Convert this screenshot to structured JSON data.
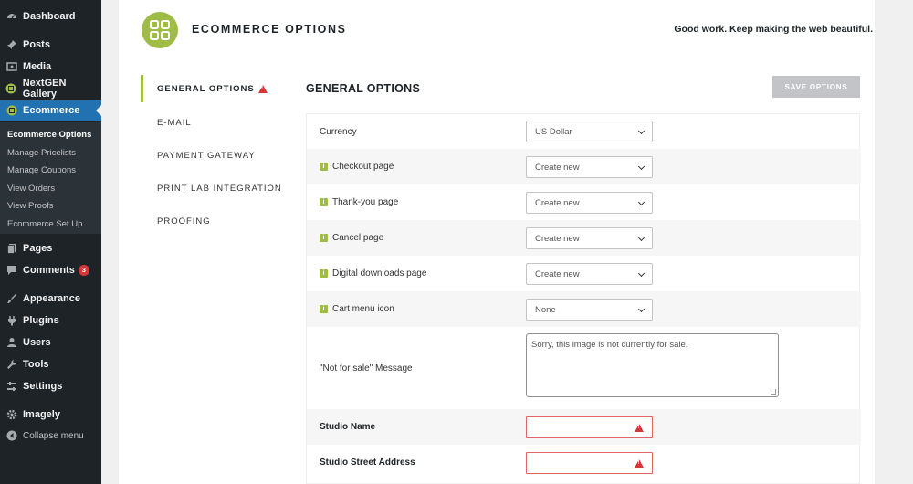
{
  "sidebar": {
    "dashboard": "Dashboard",
    "posts": "Posts",
    "media": "Media",
    "nextgen": "NextGEN Gallery",
    "ecommerce": "Ecommerce",
    "submenu": [
      "Ecommerce Options",
      "Manage Pricelists",
      "Manage Coupons",
      "View Orders",
      "View Proofs",
      "Ecommerce Set Up"
    ],
    "pages": "Pages",
    "comments": "Comments",
    "comments_count": "3",
    "appearance": "Appearance",
    "plugins": "Plugins",
    "users": "Users",
    "tools": "Tools",
    "settings": "Settings",
    "imagely": "Imagely",
    "collapse": "Collapse menu"
  },
  "header": {
    "title": "ECOMMERCE OPTIONS",
    "tagline": "Good work. Keep making the web beautiful."
  },
  "tabs": [
    "GENERAL OPTIONS",
    "E-MAIL",
    "PAYMENT GATEWAY",
    "PRINT LAB INTEGRATION",
    "PROOFING"
  ],
  "section": {
    "title": "GENERAL OPTIONS",
    "save_label": "SAVE OPTIONS"
  },
  "form": {
    "currency": {
      "label": "Currency",
      "value": "US Dollar"
    },
    "checkout": {
      "label": "Checkout page",
      "value": "Create new"
    },
    "thankyou": {
      "label": "Thank-you page",
      "value": "Create new"
    },
    "cancel": {
      "label": "Cancel page",
      "value": "Create new"
    },
    "digital": {
      "label": "Digital downloads page",
      "value": "Create new"
    },
    "cart_icon": {
      "label": "Cart menu icon",
      "value": "None"
    },
    "not_for_sale": {
      "label": "\"Not for sale\" Message",
      "value": "Sorry, this image is not currently for sale."
    },
    "studio_name": {
      "label": "Studio Name",
      "value": ""
    },
    "studio_address": {
      "label": "Studio Street Address",
      "value": ""
    }
  },
  "colors": {
    "accent": "#9fbd46",
    "wp_blue": "#2271b1",
    "error": "#d63638"
  }
}
